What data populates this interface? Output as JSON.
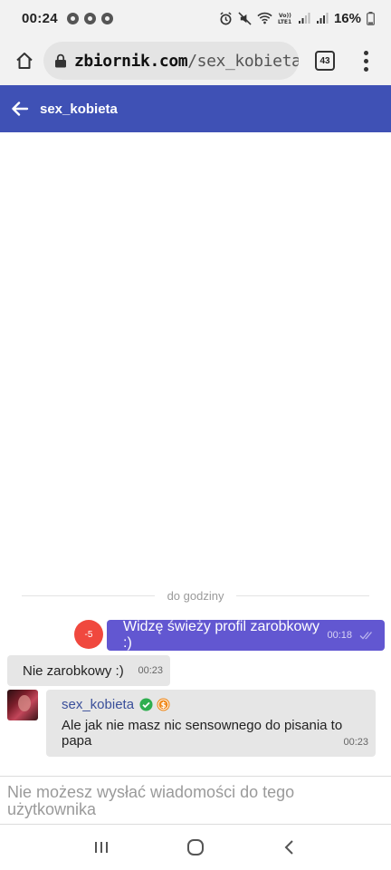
{
  "status_bar": {
    "time": "00:24",
    "battery": "16%"
  },
  "browser": {
    "url_host": "zbiornik.com",
    "url_path": "/sex_kobieta",
    "tab_count": "43"
  },
  "header": {
    "title": "sex_kobieta"
  },
  "chat": {
    "divider_label": "do godziny",
    "messages": [
      {
        "direction": "out",
        "badge": "-5",
        "text": "Widzę świeży profil zarobkowy :)",
        "time": "00:18"
      },
      {
        "direction": "in",
        "text": "Nie zarobkowy :)",
        "time": "00:23"
      },
      {
        "direction": "in",
        "sender": "sex_kobieta",
        "text": "Ale jak nie masz nic sensownego do pisania to papa",
        "time": "00:23"
      }
    ]
  },
  "input_notice": "Nie możesz wysłać wiadomości do tego użytkownika",
  "colors": {
    "header": "#3f51b5",
    "outgoing_bubble": "#6257d1",
    "incoming_bubble": "#e6e6e6",
    "badge": "#f0483e",
    "verified": "#2eae4f",
    "coin": "#f08a1c"
  }
}
